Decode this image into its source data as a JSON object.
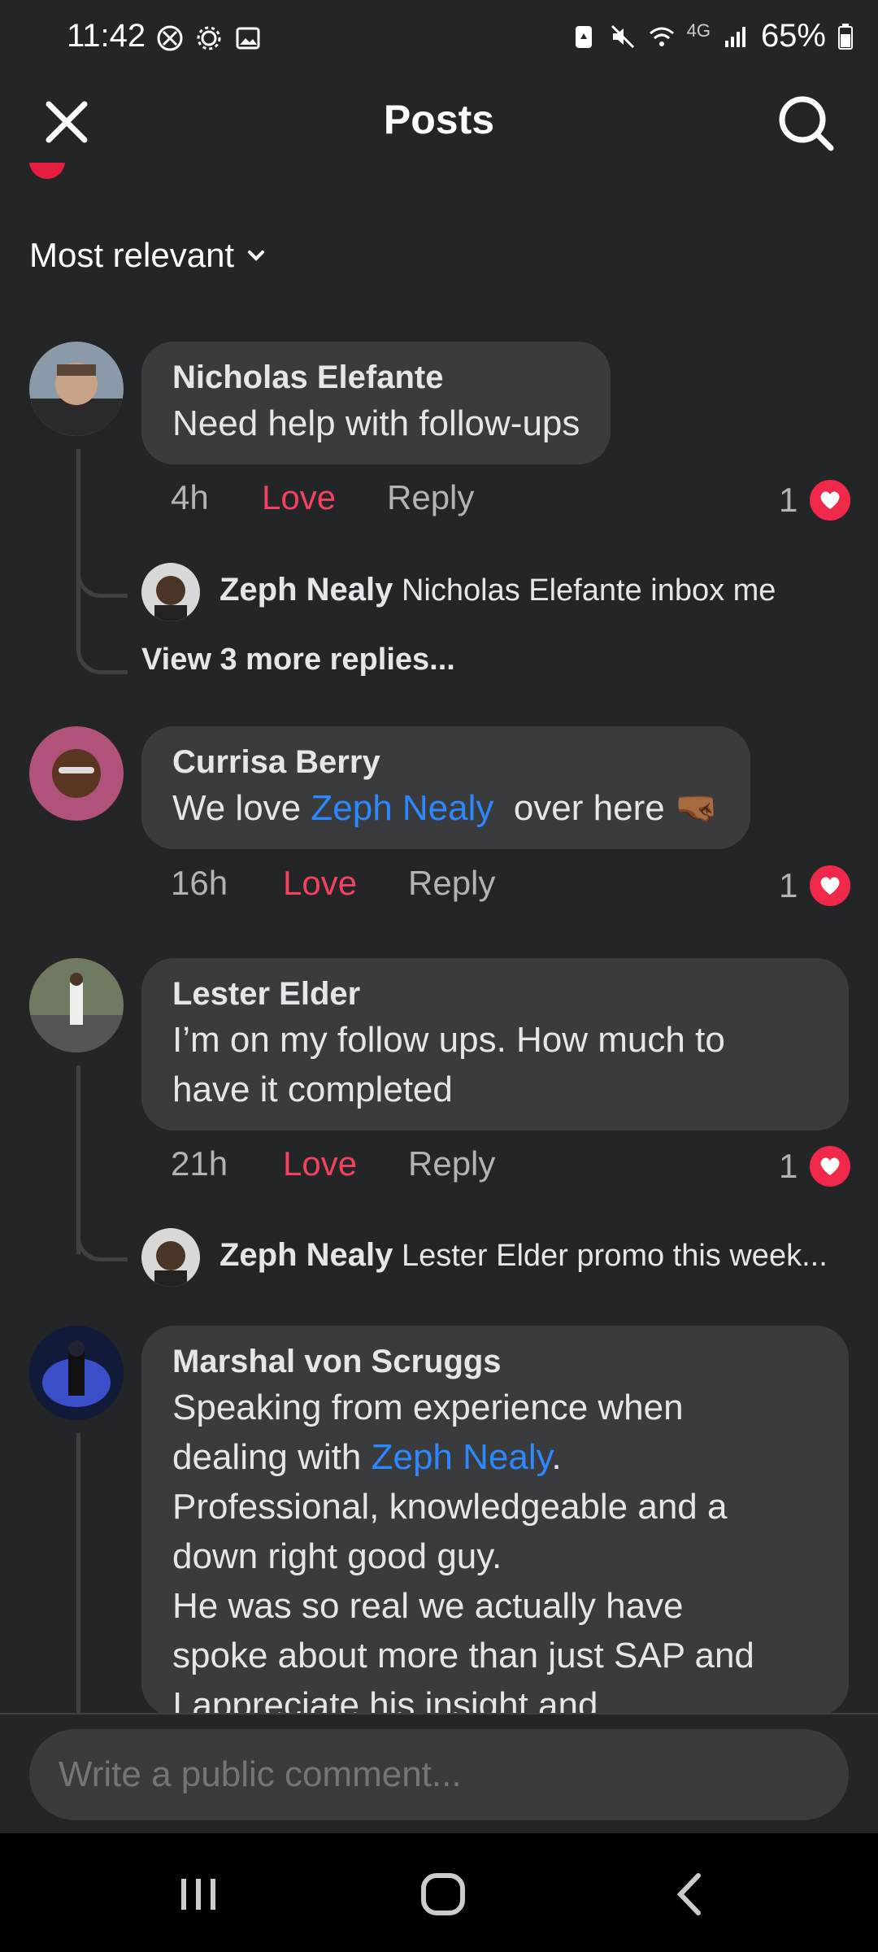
{
  "status_bar": {
    "time": "11:42",
    "network": "4G",
    "battery": "65%"
  },
  "header": {
    "title": "Posts"
  },
  "sort": {
    "label": "Most relevant"
  },
  "comments": [
    {
      "author": "Nicholas Elefante",
      "text": "Need help with follow-ups",
      "time": "4h",
      "love_label": "Love",
      "reply_label": "Reply",
      "reaction_count": "1",
      "replies": [
        {
          "author": "Zeph Nealy",
          "text": "Nicholas Elefante inbox me"
        }
      ],
      "view_more": "View 3 more replies..."
    },
    {
      "author": "Currisa Berry",
      "text_before": "We love ",
      "mention": "Zeph Nealy",
      "text_after": "  over here 🤜🏾",
      "time": "16h",
      "love_label": "Love",
      "reply_label": "Reply",
      "reaction_count": "1"
    },
    {
      "author": "Lester Elder",
      "text_line1": "I’m on my follow ups. How much to",
      "text_line2": "have it completed",
      "time": "21h",
      "love_label": "Love",
      "reply_label": "Reply",
      "reaction_count": "1",
      "replies": [
        {
          "author": "Zeph Nealy",
          "text": "Lester Elder promo this week..."
        }
      ]
    },
    {
      "author": "Marshal von Scruggs",
      "line1": "Speaking from experience when",
      "line2_before": "dealing with ",
      "mention": "Zeph Nealy",
      "line2_after": ".",
      "line3": "Professional, knowledgeable and a",
      "line4": "down right good guy.",
      "line5": "He was so real we actually have",
      "line6": "spoke about more than just SAP and",
      "line7": "I appreciate his insight and"
    }
  ],
  "composer": {
    "placeholder": "Write a public comment..."
  },
  "colors": {
    "background": "#242526",
    "bubble": "#3a3b3c",
    "love": "#f3425f",
    "mention": "#2d88ff"
  }
}
